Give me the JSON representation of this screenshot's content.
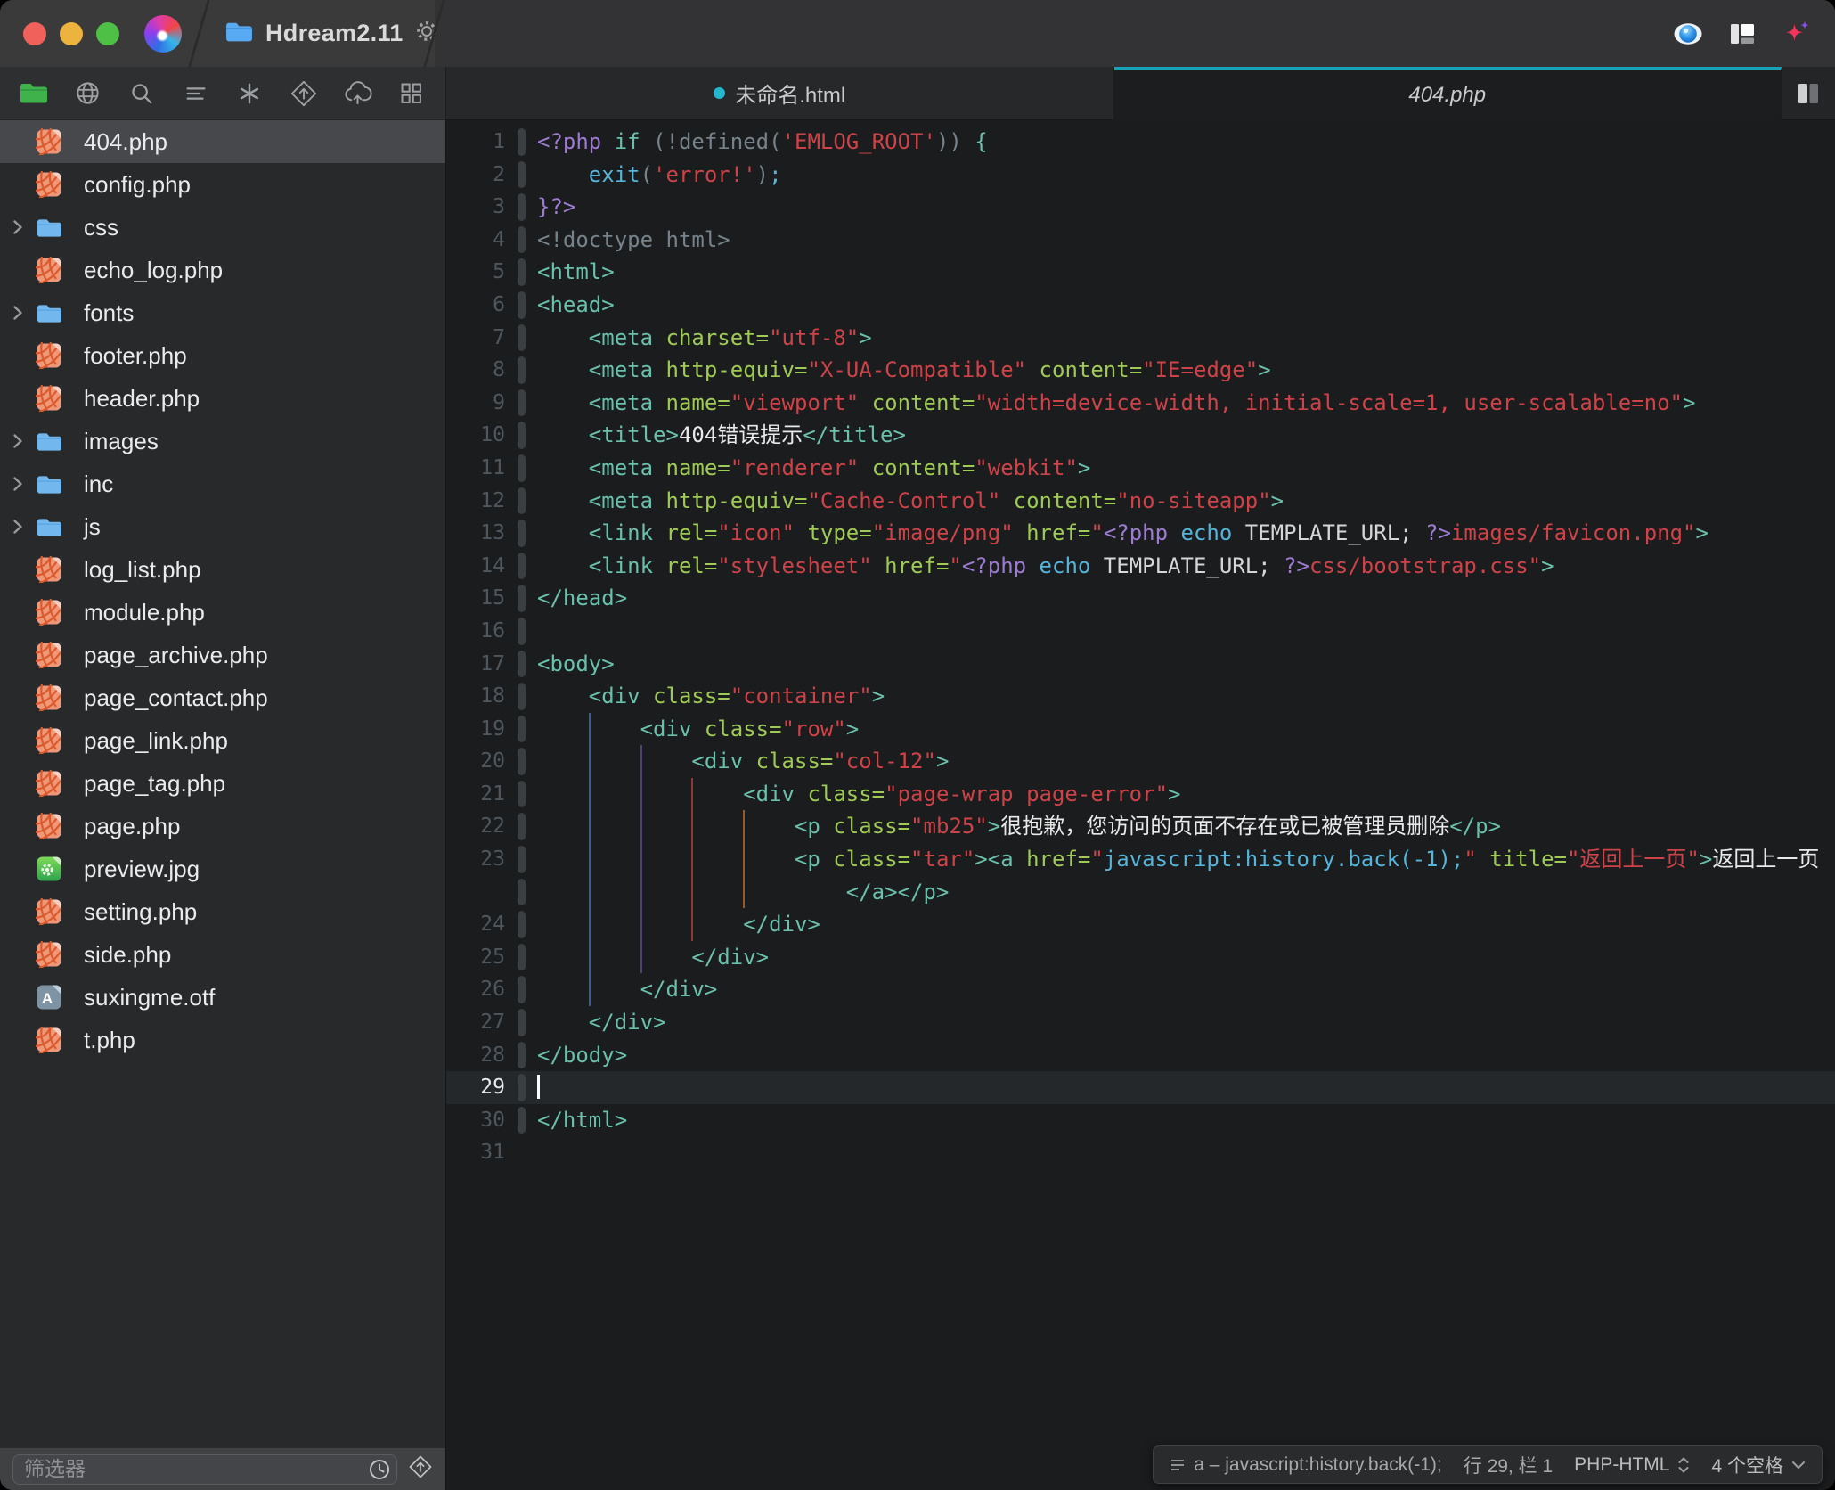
{
  "window": {
    "title": "Hdream2.11"
  },
  "tabs": [
    {
      "label": "未命名.html",
      "modified": true,
      "active": false
    },
    {
      "label": "404.php",
      "modified": false,
      "active": true
    }
  ],
  "sidebar_toolbar": [
    "folder",
    "globe",
    "search",
    "outline",
    "symbols",
    "publish",
    "sync",
    "grid"
  ],
  "sidebar": {
    "filter_placeholder": "筛选器",
    "files": [
      {
        "name": "404.php",
        "type": "php",
        "selected": true
      },
      {
        "name": "config.php",
        "type": "php"
      },
      {
        "name": "css",
        "type": "folder"
      },
      {
        "name": "echo_log.php",
        "type": "php"
      },
      {
        "name": "fonts",
        "type": "folder"
      },
      {
        "name": "footer.php",
        "type": "php"
      },
      {
        "name": "header.php",
        "type": "php"
      },
      {
        "name": "images",
        "type": "folder"
      },
      {
        "name": "inc",
        "type": "folder"
      },
      {
        "name": "js",
        "type": "folder"
      },
      {
        "name": "log_list.php",
        "type": "php"
      },
      {
        "name": "module.php",
        "type": "php"
      },
      {
        "name": "page_archive.php",
        "type": "php"
      },
      {
        "name": "page_contact.php",
        "type": "php"
      },
      {
        "name": "page_link.php",
        "type": "php"
      },
      {
        "name": "page_tag.php",
        "type": "php"
      },
      {
        "name": "page.php",
        "type": "php"
      },
      {
        "name": "preview.jpg",
        "type": "image"
      },
      {
        "name": "setting.php",
        "type": "php"
      },
      {
        "name": "side.php",
        "type": "php"
      },
      {
        "name": "suxingme.otf",
        "type": "font"
      },
      {
        "name": "t.php",
        "type": "php"
      }
    ]
  },
  "editor": {
    "lines": [
      {
        "n": 1,
        "t": [
          [
            "p",
            "<?php"
          ],
          [
            "n",
            " "
          ],
          [
            "t",
            "if"
          ],
          [
            "g",
            " (!defined("
          ],
          [
            "s",
            "'EMLOG_ROOT'"
          ],
          [
            "g",
            "))"
          ],
          [
            "t",
            " {"
          ]
        ]
      },
      {
        "n": 2,
        "t": [
          [
            "n",
            "    "
          ],
          [
            "k",
            "exit"
          ],
          [
            "g",
            "("
          ],
          [
            "s",
            "'error!'"
          ],
          [
            "g",
            ")"
          ],
          [
            "k",
            ";"
          ]
        ]
      },
      {
        "n": 3,
        "t": [
          [
            "p",
            "}?>"
          ]
        ]
      },
      {
        "n": 4,
        "t": [
          [
            "g",
            "<!doctype html>"
          ]
        ]
      },
      {
        "n": 5,
        "t": [
          [
            "t",
            "<html>"
          ]
        ]
      },
      {
        "n": 6,
        "t": [
          [
            "t",
            "<head>"
          ]
        ]
      },
      {
        "n": 7,
        "t": [
          [
            "n",
            "    "
          ],
          [
            "t",
            "<meta "
          ],
          [
            "a",
            "charset="
          ],
          [
            "s",
            "\"utf-8\""
          ],
          [
            "t",
            ">"
          ]
        ]
      },
      {
        "n": 8,
        "t": [
          [
            "n",
            "    "
          ],
          [
            "t",
            "<meta "
          ],
          [
            "a",
            "http-equiv="
          ],
          [
            "s",
            "\"X-UA-Compatible\""
          ],
          [
            "n",
            " "
          ],
          [
            "a",
            "content="
          ],
          [
            "s",
            "\"IE=edge\""
          ],
          [
            "t",
            ">"
          ]
        ]
      },
      {
        "n": 9,
        "t": [
          [
            "n",
            "    "
          ],
          [
            "t",
            "<meta "
          ],
          [
            "a",
            "name="
          ],
          [
            "s",
            "\"viewport\""
          ],
          [
            "n",
            " "
          ],
          [
            "a",
            "content="
          ],
          [
            "s",
            "\"width=device-width, initial-scale=1, user-scalable=no\""
          ],
          [
            "t",
            ">"
          ]
        ]
      },
      {
        "n": 10,
        "t": [
          [
            "n",
            "    "
          ],
          [
            "t",
            "<title>"
          ],
          [
            "w",
            "404错误提示"
          ],
          [
            "t",
            "</title>"
          ]
        ]
      },
      {
        "n": 11,
        "t": [
          [
            "n",
            "    "
          ],
          [
            "t",
            "<meta "
          ],
          [
            "a",
            "name="
          ],
          [
            "s",
            "\"renderer\""
          ],
          [
            "n",
            " "
          ],
          [
            "a",
            "content="
          ],
          [
            "s",
            "\"webkit\""
          ],
          [
            "t",
            ">"
          ]
        ]
      },
      {
        "n": 12,
        "t": [
          [
            "n",
            "    "
          ],
          [
            "t",
            "<meta "
          ],
          [
            "a",
            "http-equiv="
          ],
          [
            "s",
            "\"Cache-Control\""
          ],
          [
            "n",
            " "
          ],
          [
            "a",
            "content="
          ],
          [
            "s",
            "\"no-siteapp\""
          ],
          [
            "t",
            ">"
          ]
        ]
      },
      {
        "n": 13,
        "t": [
          [
            "n",
            "    "
          ],
          [
            "t",
            "<link "
          ],
          [
            "a",
            "rel="
          ],
          [
            "s",
            "\"icon\""
          ],
          [
            "n",
            " "
          ],
          [
            "a",
            "type="
          ],
          [
            "s",
            "\"image/png\""
          ],
          [
            "n",
            " "
          ],
          [
            "a",
            "href="
          ],
          [
            "s",
            "\""
          ],
          [
            "p",
            "<?php "
          ],
          [
            "k",
            "echo"
          ],
          [
            "n",
            " TEMPLATE_URL; "
          ],
          [
            "p",
            "?>"
          ],
          [
            "s",
            "images/favicon.png\""
          ],
          [
            "t",
            ">"
          ]
        ]
      },
      {
        "n": 14,
        "t": [
          [
            "n",
            "    "
          ],
          [
            "t",
            "<link "
          ],
          [
            "a",
            "rel="
          ],
          [
            "s",
            "\"stylesheet\""
          ],
          [
            "n",
            " "
          ],
          [
            "a",
            "href="
          ],
          [
            "s",
            "\""
          ],
          [
            "p",
            "<?php "
          ],
          [
            "k",
            "echo"
          ],
          [
            "n",
            " TEMPLATE_URL; "
          ],
          [
            "p",
            "?>"
          ],
          [
            "s",
            "css/bootstrap.css\""
          ],
          [
            "t",
            ">"
          ]
        ]
      },
      {
        "n": 15,
        "t": [
          [
            "t",
            "</head>"
          ]
        ]
      },
      {
        "n": 16,
        "t": []
      },
      {
        "n": 17,
        "t": [
          [
            "t",
            "<body>"
          ]
        ]
      },
      {
        "n": 18,
        "t": [
          [
            "n",
            "    "
          ],
          [
            "t",
            "<div "
          ],
          [
            "a",
            "class="
          ],
          [
            "s",
            "\"container\""
          ],
          [
            "t",
            ">"
          ]
        ]
      },
      {
        "n": 19,
        "g2": [
          1
        ],
        "t": [
          [
            "n",
            "        "
          ],
          [
            "t",
            "<div "
          ],
          [
            "a",
            "class="
          ],
          [
            "s",
            "\"row\""
          ],
          [
            "t",
            ">"
          ]
        ]
      },
      {
        "n": 20,
        "g2": [
          1,
          2
        ],
        "t": [
          [
            "n",
            "            "
          ],
          [
            "t",
            "<div "
          ],
          [
            "a",
            "class="
          ],
          [
            "s",
            "\"col-12\""
          ],
          [
            "t",
            ">"
          ]
        ]
      },
      {
        "n": 21,
        "g2": [
          1,
          2,
          3
        ],
        "t": [
          [
            "n",
            "                "
          ],
          [
            "t",
            "<div "
          ],
          [
            "a",
            "class="
          ],
          [
            "s",
            "\"page-wrap page-error\""
          ],
          [
            "t",
            ">"
          ]
        ]
      },
      {
        "n": 22,
        "g2": [
          1,
          2,
          3,
          4
        ],
        "t": [
          [
            "n",
            "                    "
          ],
          [
            "t",
            "<p "
          ],
          [
            "a",
            "class="
          ],
          [
            "s",
            "\"mb25\""
          ],
          [
            "t",
            ">"
          ],
          [
            "w",
            "很抱歉，您访问的页面不存在或已被管理员删除"
          ],
          [
            "t",
            "</p>"
          ]
        ]
      },
      {
        "n": 23,
        "g2": [
          1,
          2,
          3,
          4
        ],
        "t": [
          [
            "n",
            "                    "
          ],
          [
            "t",
            "<p "
          ],
          [
            "a",
            "class="
          ],
          [
            "s",
            "\"tar\""
          ],
          [
            "t",
            "><a "
          ],
          [
            "a",
            "href="
          ],
          [
            "s",
            "\""
          ],
          [
            "k",
            "javascript:history.back(-1);"
          ],
          [
            "s",
            "\""
          ],
          [
            "n",
            " "
          ],
          [
            "a",
            "title="
          ],
          [
            "s",
            "\"返回上一页\""
          ],
          [
            "t",
            ">"
          ],
          [
            "w",
            "返回上一页"
          ]
        ]
      },
      {
        "n": null,
        "g2": [
          1,
          2,
          3,
          4
        ],
        "t": [
          [
            "n",
            "                        "
          ],
          [
            "t",
            "</a></p>"
          ]
        ]
      },
      {
        "n": 24,
        "g2": [
          1,
          2,
          3
        ],
        "t": [
          [
            "n",
            "                "
          ],
          [
            "t",
            "</div>"
          ]
        ]
      },
      {
        "n": 25,
        "g2": [
          1,
          2
        ],
        "t": [
          [
            "n",
            "            "
          ],
          [
            "t",
            "</div>"
          ]
        ]
      },
      {
        "n": 26,
        "g2": [
          1
        ],
        "t": [
          [
            "n",
            "        "
          ],
          [
            "t",
            "</div>"
          ]
        ]
      },
      {
        "n": 27,
        "t": [
          [
            "n",
            "    "
          ],
          [
            "t",
            "</div>"
          ]
        ]
      },
      {
        "n": 28,
        "t": [
          [
            "t",
            "</body>"
          ]
        ]
      },
      {
        "n": 29,
        "cur": true,
        "cursor": true,
        "t": []
      },
      {
        "n": 30,
        "t": [
          [
            "t",
            "</html>"
          ]
        ]
      },
      {
        "n": 31,
        "pill": false,
        "t": []
      }
    ]
  },
  "statusbar": {
    "context": "a – javascript:history.back(-1);",
    "line_col": "行 29, 栏 1",
    "syntax": "PHP-HTML",
    "indent": "4 个空格"
  },
  "colors": {
    "accent_teal": "#16a3b9",
    "editor_bg": "#1a1c1e",
    "syntax_tag": "#6ac0ab",
    "syntax_attribute": "#9fca56",
    "syntax_string": "#cd4348",
    "syntax_php": "#9d7bd0",
    "syntax_keyword": "#55b5db",
    "php_file_icon": "#ee9878",
    "folder_icon": "#72b8ee"
  }
}
